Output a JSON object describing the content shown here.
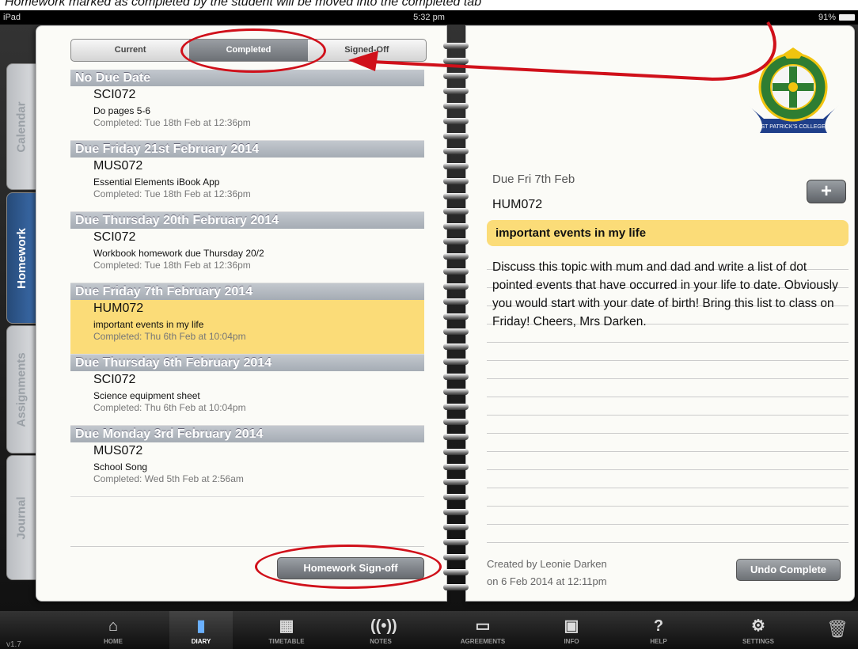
{
  "caption": "Homework marked as completed by the student will be moved into the completed tab",
  "status_bar": {
    "device": "iPad",
    "time": "5:32 pm",
    "battery": "91%"
  },
  "tabs": [
    {
      "label": "Calendar"
    },
    {
      "label": "Homework",
      "active": true
    },
    {
      "label": "Assignments"
    },
    {
      "label": "Journal"
    }
  ],
  "segments": [
    {
      "label": "Current"
    },
    {
      "label": "Completed",
      "selected": true
    },
    {
      "label": "Signed-Off"
    }
  ],
  "homework_sections": [
    {
      "heading": "No Due Date",
      "items": [
        {
          "code": "SCI072",
          "title": "Do pages 5-6",
          "completed": "Completed: Tue 18th Feb at 12:36pm"
        }
      ]
    },
    {
      "heading": "Due Friday 21st February 2014",
      "items": [
        {
          "code": "MUS072",
          "title": "Essential Elements iBook App",
          "completed": "Completed: Tue 18th Feb at 12:36pm"
        }
      ]
    },
    {
      "heading": "Due Thursday 20th February 2014",
      "items": [
        {
          "code": "SCI072",
          "title": "Workbook homework due Thursday 20/2",
          "completed": "Completed: Tue 18th Feb at 12:36pm"
        }
      ]
    },
    {
      "heading": "Due Friday 7th February 2014",
      "items": [
        {
          "code": "HUM072",
          "title": "important events in my life",
          "completed": "Completed: Thu 6th Feb at 10:04pm",
          "highlighted": true
        }
      ]
    },
    {
      "heading": "Due Thursday 6th February 2014",
      "items": [
        {
          "code": "SCI072",
          "title": "Science equipment sheet",
          "completed": "Completed: Thu 6th Feb at 10:04pm"
        }
      ]
    },
    {
      "heading": "Due Monday 3rd February 2014",
      "items": [
        {
          "code": "MUS072",
          "title": "School Song",
          "completed": "Completed: Wed 5th Feb at 2:56am"
        }
      ]
    }
  ],
  "signoff_button": "Homework Sign-off",
  "detail": {
    "due": "Due Fri 7th Feb",
    "subject": "HUM072",
    "add_button": "+",
    "title": "important events in my life",
    "description": "Discuss this topic with mum and dad and write a list of dot pointed events that have occurred in your life to date. Obviously you would start with your date of birth!  Bring this list to class on Friday!  Cheers, Mrs Darken.",
    "created_line1": "Created by Leonie Darken",
    "created_line2": "on 6 Feb 2014 at 12:11pm",
    "undo_button": "Undo Complete"
  },
  "school_logo_text": "ST PATRICK'S COLLEGE",
  "toolbar": {
    "version": "v1.7",
    "items": [
      {
        "label": "HOME",
        "icon": "home-icon"
      },
      {
        "label": "DIARY",
        "icon": "diary-icon",
        "active": true
      },
      {
        "label": "TIMETABLE",
        "icon": "timetable-icon"
      },
      {
        "label": "NOTES",
        "icon": "notes-icon"
      },
      {
        "label": "AGREEMENTS",
        "icon": "agreements-icon"
      },
      {
        "label": "INFO",
        "icon": "info-icon"
      },
      {
        "label": "HELP",
        "icon": "help-icon"
      },
      {
        "label": "SETTINGS",
        "icon": "settings-icon"
      }
    ],
    "trash_icon": "trash-icon"
  },
  "colors": {
    "highlight": "#fbdc78",
    "active_tab": "#2d558a",
    "annotation": "#d0101a"
  }
}
